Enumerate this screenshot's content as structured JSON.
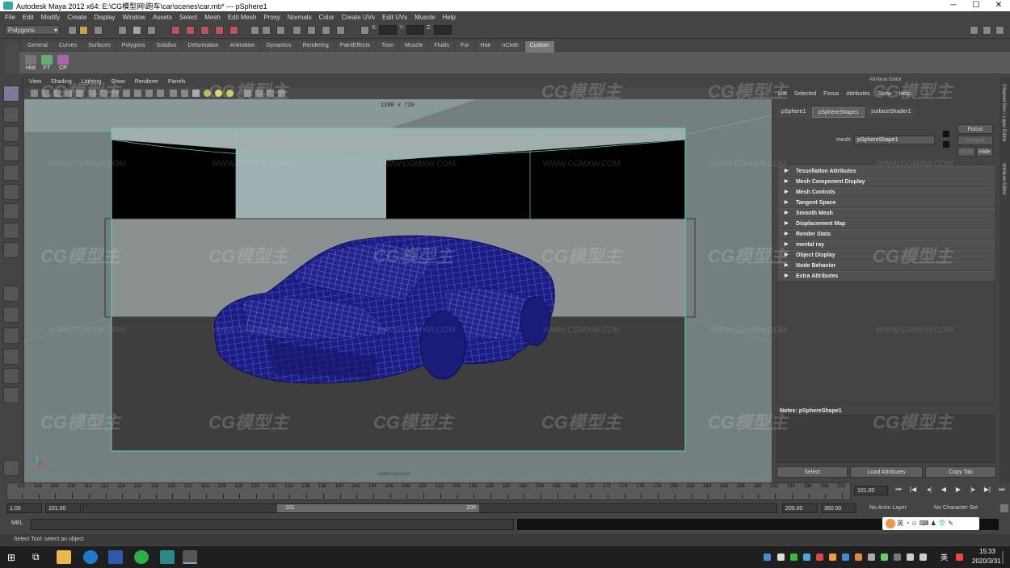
{
  "window": {
    "title": "Autodesk Maya 2012 x64: E:\\CG模型网\\跑车\\car\\scenes\\car.mb*  ---  pSphere1",
    "minimize": "─",
    "maximize": "☐",
    "close": "✕"
  },
  "menubar": [
    "File",
    "Edit",
    "Modify",
    "Create",
    "Display",
    "Window",
    "Assets",
    "Select",
    "Mesh",
    "Edit Mesh",
    "Proxy",
    "Normals",
    "Color",
    "Create UVs",
    "Edit UVs",
    "Muscle",
    "Help"
  ],
  "statusline": {
    "mode": "Polygons",
    "x_label": "X:",
    "y_label": "Y:",
    "z_label": "Z:"
  },
  "shelf": {
    "tabs": [
      "General",
      "Curves",
      "Surfaces",
      "Polygons",
      "Subdivs",
      "Deformation",
      "Animation",
      "Dynamics",
      "Rendering",
      "PaintEffects",
      "Toon",
      "Muscle",
      "Fluids",
      "Fur",
      "Hair",
      "nCloth",
      "Custom"
    ],
    "active_tab": "Custom",
    "buttons": [
      "Hist",
      "FT",
      "CP"
    ]
  },
  "viewport": {
    "menu": [
      "View",
      "Shading",
      "Lighting",
      "Show",
      "Renderer",
      "Panels"
    ],
    "resolution_label": "1280 x 720",
    "camera_label": "camerakazer"
  },
  "attribute_editor": {
    "header": "Attribute Editor",
    "menu": [
      "List",
      "Selected",
      "Focus",
      "Attributes",
      "Show",
      "Help"
    ],
    "tabs": [
      "pSphere1",
      "pSphereShape1",
      "surfaceShader1"
    ],
    "active_tab": "pSphereShape1",
    "mesh_label": "mesh:",
    "mesh_value": "pSphereShape1",
    "focus_btn": "Focus",
    "presets_btn": "Presets",
    "show_btn": "Show",
    "hide_btn": "Hide",
    "sections": [
      "Tessellation Attributes",
      "Mesh Component Display",
      "Mesh Controls",
      "Tangent Space",
      "Smooth Mesh",
      "Displacement Map",
      "Render Stats",
      "mental ray",
      "Object Display",
      "Node Behavior",
      "Extra Attributes"
    ],
    "notes_label": "Notes:  pSphereShape1",
    "buttons": [
      "Select",
      "Load Attributes",
      "Copy Tab"
    ]
  },
  "side_tabs": [
    "Channel Box / Layer Editor",
    "Attribute Editor"
  ],
  "timeline": {
    "ticks": [
      "102",
      "104",
      "106",
      "108",
      "110",
      "112",
      "114",
      "116",
      "118",
      "120",
      "122",
      "124",
      "126",
      "128",
      "130",
      "132",
      "134",
      "136",
      "138",
      "140",
      "142",
      "144",
      "146",
      "148",
      "150",
      "152",
      "154",
      "156",
      "158",
      "160",
      "162",
      "164",
      "166",
      "168",
      "170",
      "172",
      "174",
      "176",
      "178",
      "180",
      "182",
      "184",
      "186",
      "188",
      "190",
      "192",
      "194",
      "196",
      "198",
      "200"
    ],
    "current_frame": "101.00"
  },
  "range": {
    "start": "1.00",
    "playback_start": "101.00",
    "slider_start": "101",
    "slider_end": "200",
    "playback_end": "200.00",
    "end": "360.00",
    "anim_layer": "No Anim Layer",
    "char_set": "No Character Set"
  },
  "cmdline": {
    "label": "MEL"
  },
  "helpline": "Select Tool: select an object",
  "taskbar": {
    "time": "15:33",
    "date": "2020/3/31",
    "ime": "英",
    "ime_bar": "英 ◔ ☺ ⌨ ♟ 👕 ✎"
  },
  "watermarks": {
    "brand": "CG模型主",
    "url": "WWW.CGMXW.COM"
  },
  "colors": {
    "mesh_blue": "#20208a",
    "wire": "#9aa0e6",
    "selection_green": "#5fd3b3"
  }
}
